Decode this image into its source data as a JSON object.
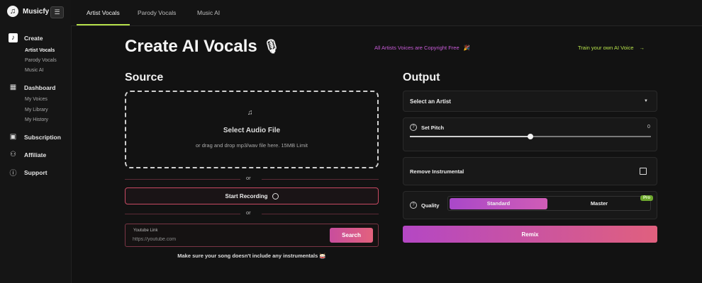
{
  "brand": {
    "name": "Musicfy",
    "logo_glyph": "♫",
    "collapse_glyph": "☰"
  },
  "sidebar": {
    "sections": [
      {
        "label": "Create",
        "icon": "music-note-icon",
        "glyph": "♪",
        "active": true,
        "items": [
          {
            "label": "Artist Vocals",
            "active": true
          },
          {
            "label": "Parody Vocals"
          },
          {
            "label": "Music AI"
          }
        ]
      },
      {
        "label": "Dashboard",
        "icon": "grid-icon",
        "glyph": "▦",
        "items": [
          {
            "label": "My Voices"
          },
          {
            "label": "My Library"
          },
          {
            "label": "My History"
          }
        ]
      },
      {
        "label": "Subscription",
        "icon": "card-icon",
        "glyph": "▣",
        "items": []
      },
      {
        "label": "Affiliate",
        "icon": "people-icon",
        "glyph": "⚇",
        "items": []
      },
      {
        "label": "Support",
        "icon": "info-icon",
        "glyph": "ⓘ",
        "items": []
      }
    ]
  },
  "tabs": [
    {
      "label": "Artist Vocals",
      "active": true
    },
    {
      "label": "Parody Vocals"
    },
    {
      "label": "Music AI"
    }
  ],
  "header": {
    "title": "Create AI Vocals",
    "title_icon": "🎙",
    "copyright": "All Artists Voices are Copyright Free",
    "copyright_icon": "🎉",
    "train": "Train your own AI Voice",
    "train_icon": "→"
  },
  "source": {
    "title": "Source",
    "upload_icon": "♫",
    "upload_title": "Select Audio File",
    "upload_sub": "or drag and drop mp3/wav file here. 15MB Limit",
    "or": "or",
    "record_label": "Start Recording",
    "youtube_label": "Youtube Link",
    "youtube_placeholder": "https://youtube.com",
    "search_label": "Search",
    "tip": "Make sure your song doesn't include any instrumentals 🥁"
  },
  "output": {
    "title": "Output",
    "artist_select": "Select an Artist",
    "caret": "▼",
    "help_glyph": "?",
    "pitch_label": "Set Pitch",
    "pitch_value": "0",
    "pitch_fraction": 0.5,
    "remove_instrumental": "Remove Instrumental",
    "remove_checked": false,
    "quality_label": "Quality",
    "quality_options": [
      {
        "label": "Standard",
        "active": true
      },
      {
        "label": "Master"
      }
    ],
    "pro_badge": "Pro",
    "remix_label": "Remix"
  },
  "colors": {
    "accent_green": "#b5e04a",
    "accent_pink": "#c85bd8",
    "gradient_start": "#b447c4",
    "gradient_end": "#e0607e"
  }
}
